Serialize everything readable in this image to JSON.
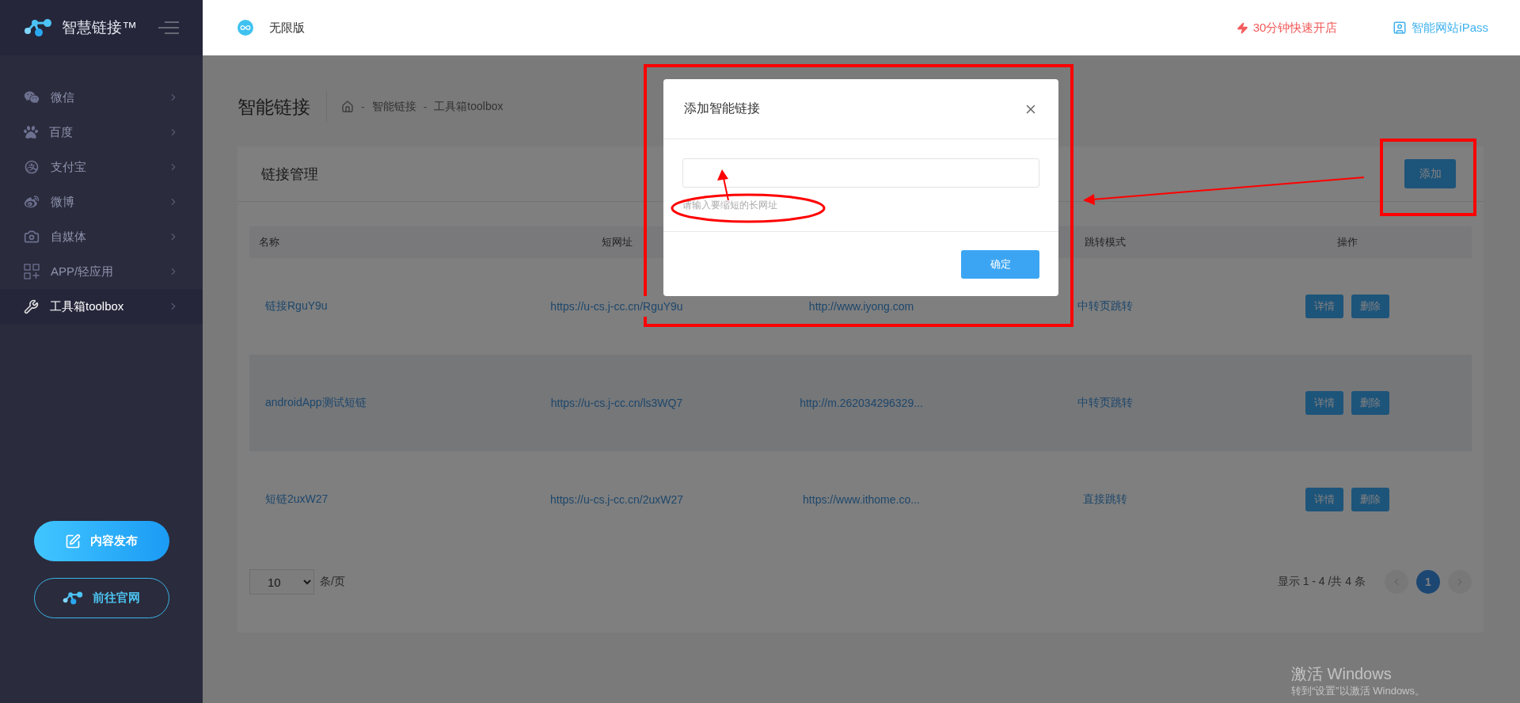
{
  "sidebar": {
    "brand": "智慧链接™",
    "items": [
      {
        "label": "微信",
        "selected": false
      },
      {
        "label": "百度",
        "selected": false
      },
      {
        "label": "支付宝",
        "selected": false
      },
      {
        "label": "微博",
        "selected": false
      },
      {
        "label": "自媒体",
        "selected": false
      },
      {
        "label": "APP/轻应用",
        "selected": false
      },
      {
        "label": "工具箱toolbox",
        "selected": true
      }
    ],
    "buttons": [
      {
        "label": "内容发布",
        "kind": "primary"
      },
      {
        "label": "前往官网",
        "kind": "outline"
      }
    ]
  },
  "topbar": {
    "plan": "无限版",
    "links": [
      {
        "label": "30分钟快速开店",
        "kind": "promo"
      },
      {
        "label": "智能网站iPass",
        "kind": "site"
      }
    ]
  },
  "page": {
    "title": "智能链接",
    "separator": "-",
    "breadcrumb": [
      "智能链接",
      "工具箱toolbox"
    ]
  },
  "card": {
    "title": "链接管理",
    "add_button": "添加",
    "table": {
      "columns": [
        {
          "label": "名称"
        },
        {
          "label": "短网址"
        },
        {},
        {
          "label": "跳转模式"
        },
        {
          "label": "操作"
        }
      ],
      "rows": [
        {
          "name": "链接RguY9u",
          "short_url": "https://u-cs.j-cc.cn/RguY9u",
          "column_3": "http://www.iyong.com",
          "mode": "中转页跳转",
          "actions": [
            "详情",
            "删除"
          ]
        },
        {
          "name": "androidApp测试短链",
          "short_url": "https://u-cs.j-cc.cn/ls3WQ7",
          "column_3": "http://m.262034296329...",
          "mode": "中转页跳转",
          "actions": [
            "详情",
            "删除"
          ]
        },
        {
          "name": "短链2uxW27",
          "short_url": "https://u-cs.j-cc.cn/2uxW27",
          "column_3": "https://www.ithome.co...",
          "mode": "直接跳转",
          "actions": [
            "详情",
            "删除"
          ]
        }
      ]
    },
    "pagination": {
      "per_page": "10",
      "per_page_label": "条/页",
      "summary": "显示 1 - 4 /共 4 条",
      "prev": {
        "disabled": true
      },
      "pages": [
        {
          "label": "1",
          "selected": true
        }
      ],
      "next": {
        "disabled": true
      }
    }
  },
  "modal": {
    "title": "添加智能链接",
    "hint": "请输入要缩短的长网址",
    "confirm": "确定"
  },
  "os_watermark": {
    "title": "激活 Windows",
    "subtitle": "转到“设置”以激活 Windows。"
  }
}
